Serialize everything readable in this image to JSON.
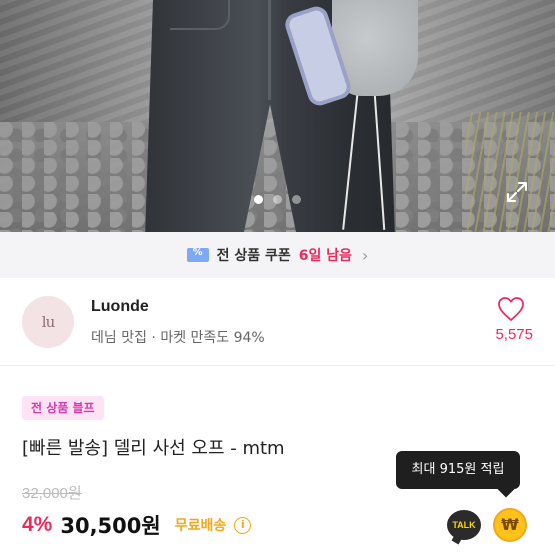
{
  "hero": {
    "photo_alt": "product-photo",
    "carousel": {
      "total": 3,
      "active_index": 0
    }
  },
  "coupon": {
    "prefix": "전 상품 쿠폰",
    "highlight": "6일 남음",
    "chevron": "›"
  },
  "shop": {
    "avatar_text": "lu",
    "name": "Luonde",
    "description": "데님 맛집 · 마켓 만족도 94%",
    "like_count": "5,575"
  },
  "product": {
    "badge": "전 상품 블프",
    "title": "[빠른 발송] 델리 사선 오프 - mtm",
    "original_price": "32,000원",
    "discount": "4%",
    "price": "30,500원",
    "shipping": "무료배송",
    "info_icon": "i"
  },
  "tooltip": {
    "text": "최대 915원 적립"
  },
  "actions": {
    "talk_label": "TALK",
    "won_label": "₩"
  },
  "colors": {
    "accent": "#ee2a5d",
    "shipping": "#f0a81e",
    "badge_text": "#d63bb1",
    "badge_bg": "#fde3f3"
  }
}
